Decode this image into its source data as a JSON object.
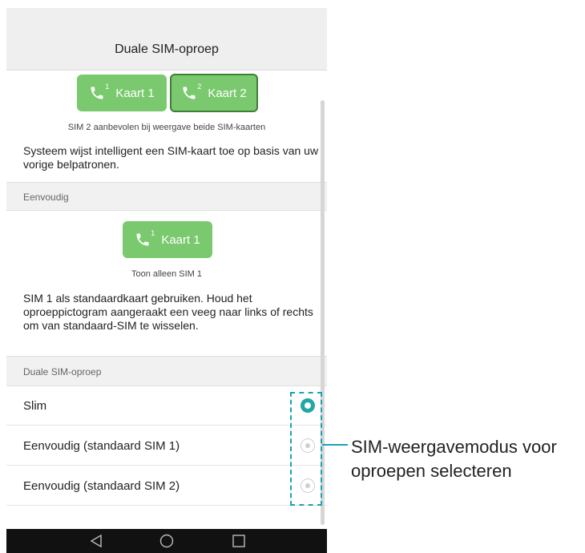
{
  "header": {
    "title": "Duale SIM-oproep"
  },
  "smart": {
    "card1_label": "Kaart 1",
    "card1_sup": "1",
    "card2_label": "Kaart 2",
    "card2_sup": "2",
    "caption": "SIM 2 aanbevolen bij weergave beide SIM-kaarten",
    "description": "Systeem wijst intelligent een SIM-kaart toe op basis van uw vorige belpatronen."
  },
  "simple": {
    "section_title": "Eenvoudig",
    "card1_label": "Kaart 1",
    "card1_sup": "1",
    "caption": "Toon alleen SIM 1",
    "description": "SIM 1 als standaardkaart gebruiken. Houd het oproeppictogram aangeraakt een veeg naar links of rechts om van standaard-SIM te wisselen."
  },
  "options": {
    "section_title": "Duale SIM-oproep",
    "items": [
      {
        "label": "Slim",
        "selected": true
      },
      {
        "label": "Eenvoudig (standaard SIM 1)",
        "selected": false
      },
      {
        "label": "Eenvoudig (standaard SIM 2)",
        "selected": false
      }
    ]
  },
  "callout": {
    "text": "SIM-weergavemodus voor oproepen selecteren"
  },
  "colors": {
    "accent": "#21a7a6",
    "button_green": "#7bc96f",
    "callout": "#1ba3b3"
  },
  "icons": [
    "phone-icon",
    "back-icon",
    "home-icon",
    "recents-icon"
  ]
}
